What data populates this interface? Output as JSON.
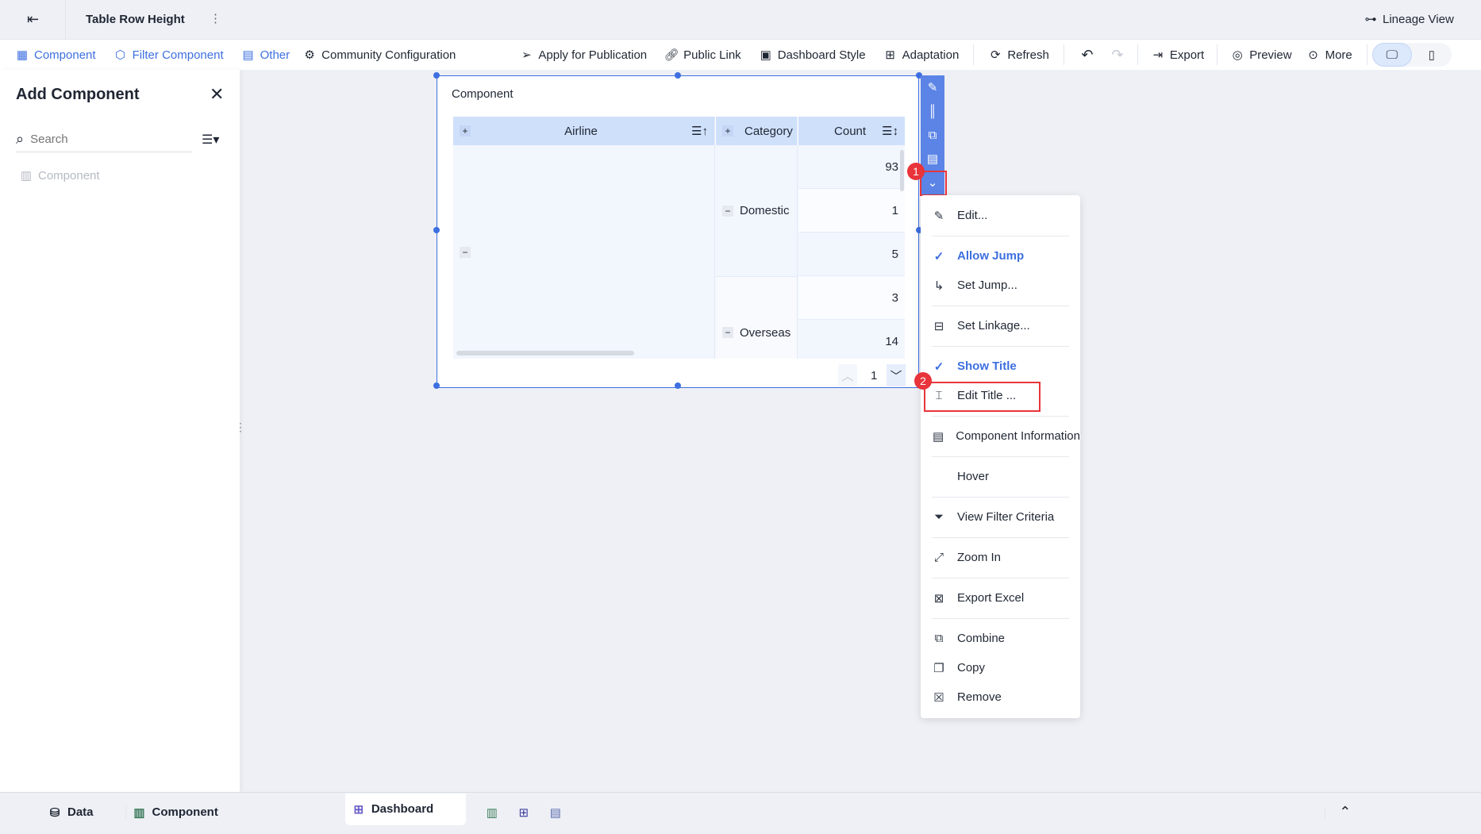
{
  "header": {
    "title": "Table Row Height",
    "lineage_view": "Lineage View"
  },
  "toolbar": {
    "component": "Component",
    "filter_component": "Filter Component",
    "other": "Other",
    "community_configuration": "Community Configuration",
    "apply_for_publication": "Apply for Publication",
    "public_link": "Public Link",
    "dashboard_style": "Dashboard Style",
    "adaptation": "Adaptation",
    "refresh": "Refresh",
    "export": "Export",
    "preview": "Preview",
    "more": "More"
  },
  "left_panel": {
    "title": "Add Component",
    "search_placeholder": "Search",
    "items": [
      {
        "label": "Component"
      }
    ]
  },
  "card": {
    "title": "Component",
    "columns": [
      "Airline",
      "Category",
      "Count"
    ],
    "categories": [
      "Domestic",
      "Overseas"
    ],
    "counts": [
      "93",
      "1",
      "5",
      "3",
      "14"
    ],
    "page": "1"
  },
  "annotations": {
    "step1": "1",
    "step2": "2"
  },
  "menu": {
    "items": [
      "Edit...",
      "Allow Jump",
      "Set Jump...",
      "Set Linkage...",
      "Show Title",
      "Edit Title ...",
      "Component Information",
      "Hover",
      "View Filter Criteria",
      "Zoom In",
      "Export Excel",
      "Combine",
      "Copy",
      "Remove"
    ]
  },
  "bottom": {
    "data": "Data",
    "component": "Component",
    "dashboard": "Dashboard"
  },
  "colors": {
    "accent": "#3d6fe0",
    "toolbar_blue": "#5b84e6",
    "highlight_red": "#e8343a"
  }
}
